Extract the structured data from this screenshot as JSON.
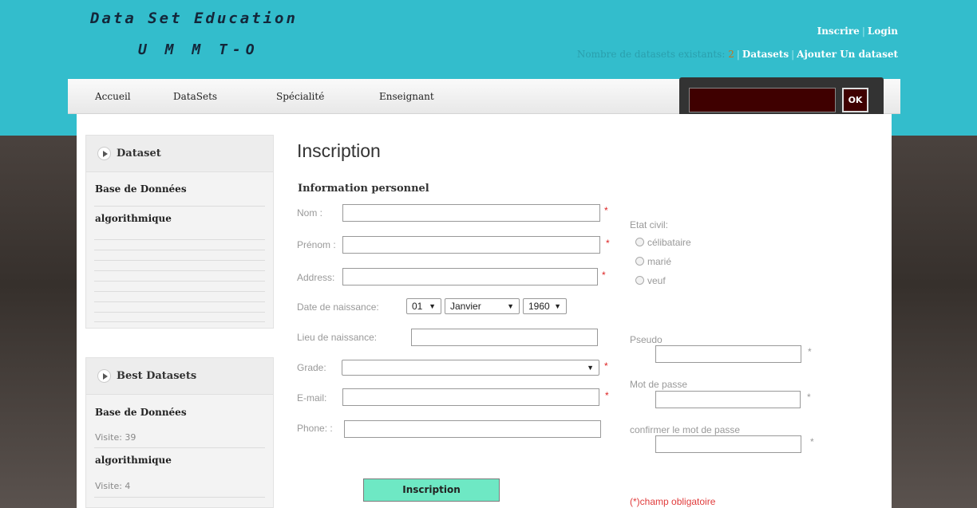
{
  "header": {
    "logo_line1": "Data Set Education",
    "logo_line2": "U M M T-O",
    "links": {
      "register": "Inscrire",
      "login": "Login"
    },
    "count_label": "Nombre de datasets existants:",
    "count_value": "2",
    "datasets_link": "Datasets",
    "add_dataset_link": "Ajouter Un dataset"
  },
  "nav": {
    "items": [
      "Accueil",
      "DataSets",
      "Spécialité",
      "Enseignant"
    ],
    "search_button": "OK"
  },
  "sidebar": {
    "dataset_box": {
      "title": "Dataset",
      "items": [
        "Base de Données",
        "algorithmique"
      ]
    },
    "best_box": {
      "title": "Best Datasets",
      "items": [
        {
          "name": "Base de Données",
          "visits": "Visite: 39"
        },
        {
          "name": "algorithmique",
          "visits": "Visite: 4"
        }
      ]
    }
  },
  "form": {
    "page_title": "Inscription",
    "section_title": "Information personnel",
    "labels": {
      "nom": "Nom :",
      "prenom": "Prénom :",
      "address": "Address:",
      "birth_date": "Date de naissance:",
      "birth_place": "Lieu de naissance:",
      "grade": "Grade:",
      "email": "E-mail:",
      "phone": "Phone: :",
      "civil_status": "Etat civil:",
      "pseudo": "Pseudo",
      "password": "Mot de passe",
      "confirm_password": "confirmer le mot de passe"
    },
    "civil_options": [
      "célibataire",
      "marié",
      "veuf"
    ],
    "birth_day": "01",
    "birth_month": "Janvier",
    "birth_year": "1960",
    "grade_value": "",
    "required_mark": "*",
    "submit_label": "Inscription",
    "required_note": "(*)champ obligatoire"
  },
  "colors": {
    "header_bg": "#33bdcc",
    "submit_bg": "#6ee8c4",
    "search_bg": "#3f0000",
    "required": "#e03b3b"
  }
}
